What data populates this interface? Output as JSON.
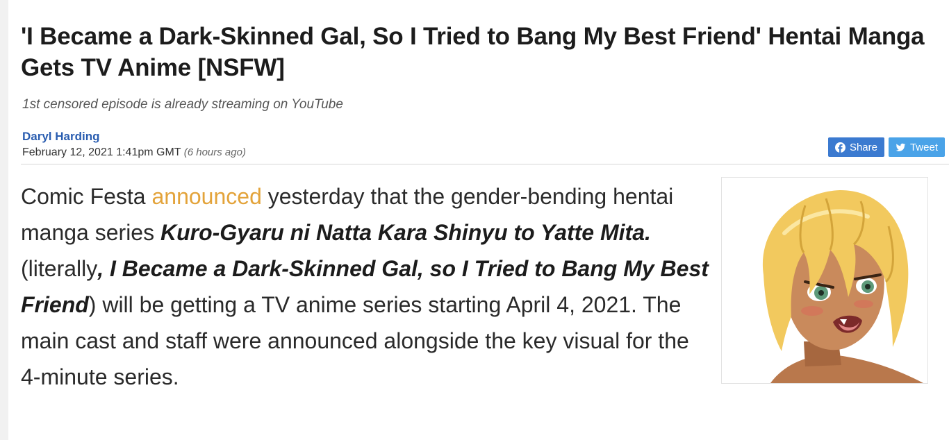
{
  "article": {
    "headline": "'I Became a Dark-Skinned Gal, So I Tried to Bang My Best Friend' Hentai Manga Gets TV Anime [NSFW]",
    "subtitle": "1st censored episode is already streaming on YouTube",
    "author": "Daryl Harding",
    "date": "February 12, 2021 1:41pm GMT",
    "relative_time": "(6 hours ago)"
  },
  "social": {
    "share_label": "Share",
    "tweet_label": "Tweet",
    "share_icon": "facebook-icon",
    "tweet_icon": "twitter-icon"
  },
  "body": {
    "p1_a": "Comic Festa ",
    "p1_link": "announced",
    "p1_b": " yesterday that the gender-bending hentai manga series ",
    "p1_title_jp": "Kuro-Gyaru ni Natta Kara Shinyu to Yatte Mita.",
    "p1_c": " (literally",
    "p1_title_en": ", I Became a Dark-Skinned Gal, so I Tried to Bang My Best Friend",
    "p1_d": ") will be getting a TV anime series starting April 4, 2021. The main cast and staff were announced alongside the key visual for the 4-minute series."
  },
  "colors": {
    "link": "#e3a33a",
    "author": "#2a5db0",
    "facebook": "#3b7ad0",
    "twitter": "#4aa3e8"
  }
}
